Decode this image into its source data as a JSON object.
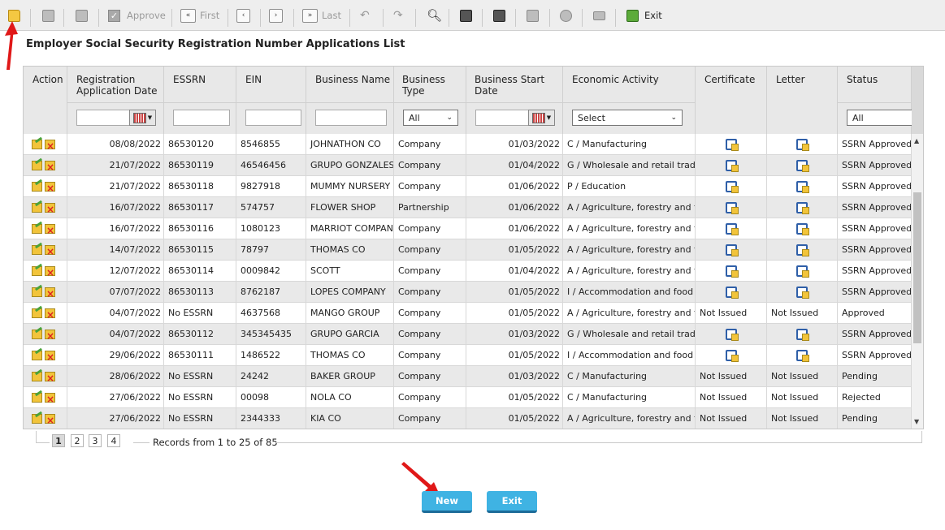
{
  "toolbar": {
    "approve": "Approve",
    "first": "First",
    "last": "Last",
    "exit": "Exit"
  },
  "page_title": "Employer Social Security Registration Number Applications List",
  "columns": [
    "Action",
    "Registration Application Date",
    "ESSRN",
    "EIN",
    "Business Name",
    "Business Type",
    "Business Start Date",
    "Economic Activity",
    "Certificate",
    "Letter",
    "Status"
  ],
  "filters": {
    "business_type": "All",
    "economic_activity": "Select",
    "status": "All"
  },
  "rows": [
    {
      "date": "08/08/2022",
      "essrn": "86530120",
      "ein": "8546855",
      "name": "JOHNATHON CO",
      "type": "Company",
      "start": "01/03/2022",
      "activity": "C / Manufacturing",
      "certificate": "icon",
      "letter": "icon",
      "status": "SSRN Approved"
    },
    {
      "date": "21/07/2022",
      "essrn": "86530119",
      "ein": "46546456",
      "name": "GRUPO GONZALES",
      "type": "Company",
      "start": "01/04/2022",
      "activity": "G / Wholesale and retail trade; re",
      "certificate": "icon",
      "letter": "icon",
      "status": "SSRN Approved"
    },
    {
      "date": "21/07/2022",
      "essrn": "86530118",
      "ein": "9827918",
      "name": "MUMMY NURSERY",
      "type": "Company",
      "start": "01/06/2022",
      "activity": "P / Education",
      "certificate": "icon",
      "letter": "icon",
      "status": "SSRN Approved"
    },
    {
      "date": "16/07/2022",
      "essrn": "86530117",
      "ein": "574757",
      "name": "FLOWER SHOP",
      "type": "Partnership",
      "start": "01/06/2022",
      "activity": "A / Agriculture, forestry and fishi",
      "certificate": "icon",
      "letter": "icon",
      "status": "SSRN Approved"
    },
    {
      "date": "16/07/2022",
      "essrn": "86530116",
      "ein": "1080123",
      "name": "MARRIOT COMPANY",
      "type": "Company",
      "start": "01/06/2022",
      "activity": "A / Agriculture, forestry and fishi",
      "certificate": "icon",
      "letter": "icon",
      "status": "SSRN Approved"
    },
    {
      "date": "14/07/2022",
      "essrn": "86530115",
      "ein": "78797",
      "name": "THOMAS CO",
      "type": "Company",
      "start": "01/05/2022",
      "activity": "A / Agriculture, forestry and fishi",
      "certificate": "icon",
      "letter": "icon",
      "status": "SSRN Approved"
    },
    {
      "date": "12/07/2022",
      "essrn": "86530114",
      "ein": "0009842",
      "name": "SCOTT",
      "type": "Company",
      "start": "01/04/2022",
      "activity": "A / Agriculture, forestry and fishi",
      "certificate": "icon",
      "letter": "icon",
      "status": "SSRN Approved"
    },
    {
      "date": "07/07/2022",
      "essrn": "86530113",
      "ein": "8762187",
      "name": "LOPES COMPANY",
      "type": "Company",
      "start": "01/05/2022",
      "activity": "I / Accommodation and food serv",
      "certificate": "icon",
      "letter": "icon",
      "status": "SSRN Approved"
    },
    {
      "date": "04/07/2022",
      "essrn": "No ESSRN",
      "ein": "4637568",
      "name": "MANGO GROUP",
      "type": "Company",
      "start": "01/05/2022",
      "activity": "A / Agriculture, forestry and fishi",
      "certificate": "Not Issued",
      "letter": "Not Issued",
      "status": "Approved"
    },
    {
      "date": "04/07/2022",
      "essrn": "86530112",
      "ein": "345345435",
      "name": "GRUPO GARCIA",
      "type": "Company",
      "start": "01/03/2022",
      "activity": "G / Wholesale and retail trade; re",
      "certificate": "icon",
      "letter": "icon",
      "status": "SSRN Approved"
    },
    {
      "date": "29/06/2022",
      "essrn": "86530111",
      "ein": "1486522",
      "name": "THOMAS CO",
      "type": "Company",
      "start": "01/05/2022",
      "activity": "I / Accommodation and food serv",
      "certificate": "icon",
      "letter": "icon",
      "status": "SSRN Approved"
    },
    {
      "date": "28/06/2022",
      "essrn": "No ESSRN",
      "ein": "24242",
      "name": "BAKER GROUP",
      "type": "Company",
      "start": "01/03/2022",
      "activity": "C / Manufacturing",
      "certificate": "Not Issued",
      "letter": "Not Issued",
      "status": "Pending"
    },
    {
      "date": "27/06/2022",
      "essrn": "No ESSRN",
      "ein": "00098",
      "name": "NOLA CO",
      "type": "Company",
      "start": "01/05/2022",
      "activity": "C / Manufacturing",
      "certificate": "Not Issued",
      "letter": "Not Issued",
      "status": "Rejected"
    },
    {
      "date": "27/06/2022",
      "essrn": "No ESSRN",
      "ein": "2344333",
      "name": "KIA CO",
      "type": "Company",
      "start": "01/05/2022",
      "activity": "A / Agriculture, forestry and fishi",
      "certificate": "Not Issued",
      "letter": "Not Issued",
      "status": "Pending"
    }
  ],
  "pager": {
    "pages": [
      "1",
      "2",
      "3",
      "4"
    ],
    "current": "1",
    "records": "Records from 1 to 25 of 85"
  },
  "buttons": {
    "new": "New",
    "exit": "Exit"
  }
}
